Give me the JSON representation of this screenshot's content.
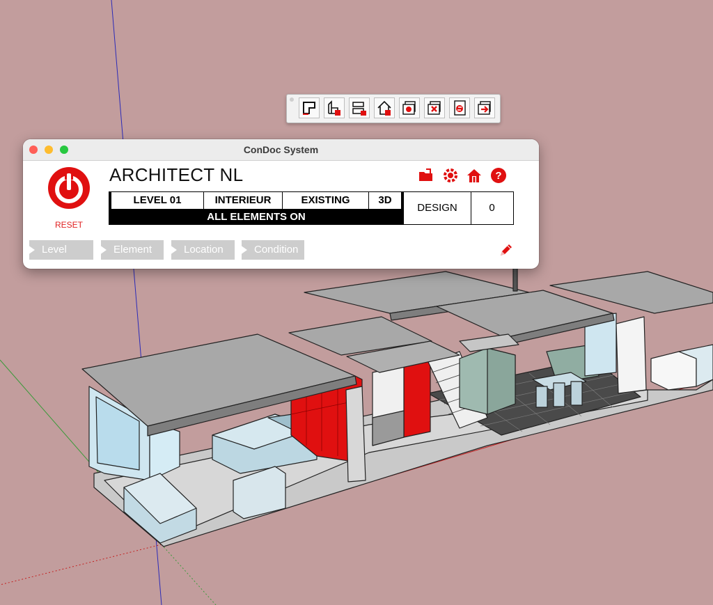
{
  "window": {
    "title": "ConDoc System",
    "traffic_lights": [
      "#ff5f57",
      "#febc2e",
      "#28c840"
    ]
  },
  "app": {
    "title": "ARCHITECT NL",
    "reset_label": "RESET",
    "accent_color": "#e02020"
  },
  "status": {
    "level": "LEVEL 01",
    "discipline": "INTERIEUR",
    "phase": "EXISTING",
    "view": "3D",
    "elements": "ALL ELEMENTS ON",
    "design_label": "DESIGN",
    "design_count": "0"
  },
  "filters": [
    {
      "label": "Level"
    },
    {
      "label": "Element"
    },
    {
      "label": "Location"
    },
    {
      "label": "Condition"
    }
  ],
  "header_icons": [
    "folder-icon",
    "gear-sync-icon",
    "building-icon",
    "help-icon"
  ],
  "toolbar": {
    "buttons": [
      "floor-plan-icon",
      "elevation-icon",
      "section-icon",
      "house-icon",
      "layers-refresh-icon",
      "layers-delete-icon",
      "page-refresh-icon",
      "export-icon"
    ]
  },
  "colors": {
    "viewport_background": "#c29d9d",
    "model_red": "#e01010"
  }
}
